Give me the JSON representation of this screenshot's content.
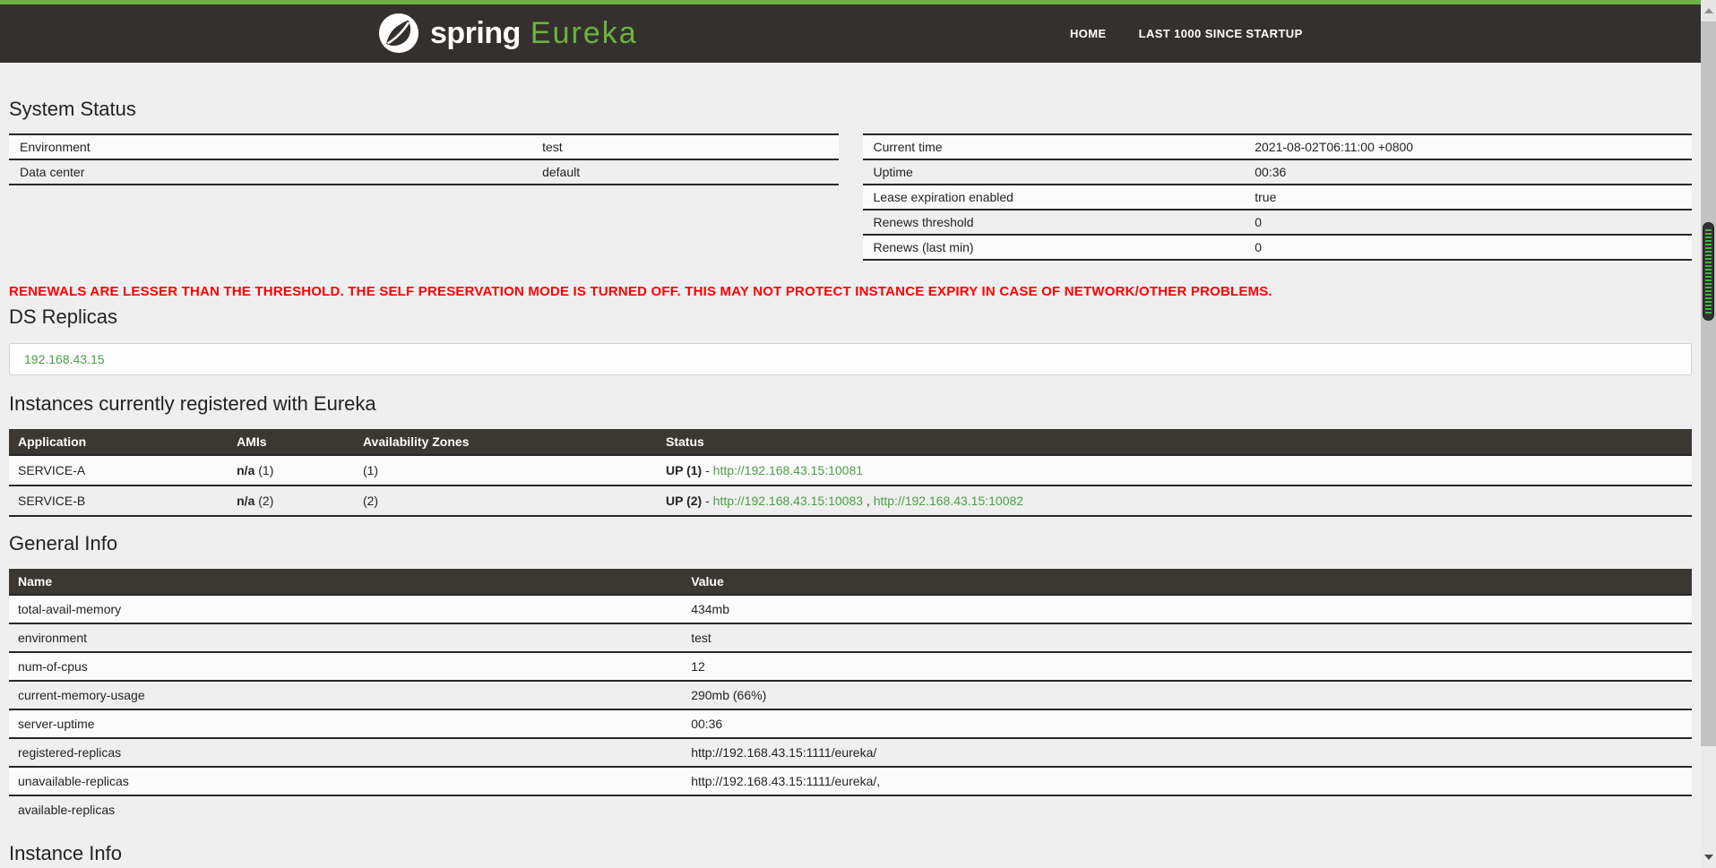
{
  "navbar": {
    "brand_white": "spring",
    "brand_green": "Eureka",
    "items": [
      {
        "label": "HOME"
      },
      {
        "label": "LAST 1000 SINCE STARTUP"
      }
    ]
  },
  "system_status": {
    "heading": "System Status",
    "left_rows": [
      {
        "label": "Environment",
        "value": "test"
      },
      {
        "label": "Data center",
        "value": "default"
      }
    ],
    "right_rows": [
      {
        "label": "Current time",
        "value": "2021-08-02T06:11:00 +0800"
      },
      {
        "label": "Uptime",
        "value": "00:36"
      },
      {
        "label": "Lease expiration enabled",
        "value": "true"
      },
      {
        "label": "Renews threshold",
        "value": "0"
      },
      {
        "label": "Renews (last min)",
        "value": "0"
      }
    ]
  },
  "warning": "RENEWALS ARE LESSER THAN THE THRESHOLD. THE SELF PRESERVATION MODE IS TURNED OFF. THIS MAY NOT PROTECT INSTANCE EXPIRY IN CASE OF NETWORK/OTHER PROBLEMS.",
  "ds_replicas": {
    "heading": "DS Replicas",
    "replica": "192.168.43.15"
  },
  "instances": {
    "heading": "Instances currently registered with Eureka",
    "columns": [
      "Application",
      "AMIs",
      "Availability Zones",
      "Status"
    ],
    "rows": [
      {
        "application": "SERVICE-A",
        "amis_bold": "n/a",
        "amis_rest": " (1)",
        "zones": "(1)",
        "status_bold": "UP (1)",
        "status_sep": " - ",
        "links": [
          "http://192.168.43.15:10081"
        ]
      },
      {
        "application": "SERVICE-B",
        "amis_bold": "n/a",
        "amis_rest": " (2)",
        "zones": "(2)",
        "status_bold": "UP (2)",
        "status_sep": " - ",
        "links": [
          "http://192.168.43.15:10083",
          "http://192.168.43.15:10082"
        ],
        "link_sep": " , "
      }
    ]
  },
  "general_info": {
    "heading": "General Info",
    "columns": [
      "Name",
      "Value"
    ],
    "rows": [
      {
        "name": "total-avail-memory",
        "value": "434mb"
      },
      {
        "name": "environment",
        "value": "test"
      },
      {
        "name": "num-of-cpus",
        "value": "12"
      },
      {
        "name": "current-memory-usage",
        "value": "290mb (66%)"
      },
      {
        "name": "server-uptime",
        "value": "00:36"
      },
      {
        "name": "registered-replicas",
        "value": "http://192.168.43.15:1111/eureka/"
      },
      {
        "name": "unavailable-replicas",
        "value": "http://192.168.43.15:1111/eureka/,"
      },
      {
        "name": "available-replicas",
        "value": ""
      }
    ]
  },
  "instance_info": {
    "heading": "Instance Info"
  },
  "colors": {
    "accent_green": "#6db33f",
    "link_green": "#4c9e45",
    "warning_red": "#ff0000",
    "table_header_dark": "#3b3733",
    "navbar_dark": "#34302d"
  }
}
